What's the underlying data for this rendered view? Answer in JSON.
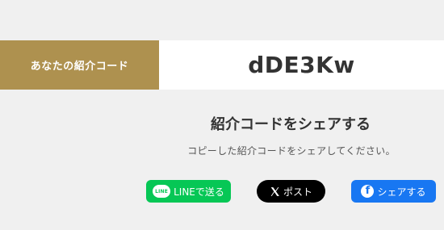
{
  "referral": {
    "label": "あなたの紹介コード",
    "code": "dDE3Kw"
  },
  "share": {
    "title": "紹介コードをシェアする",
    "description": "コピーした紹介コードをシェアしてください。"
  },
  "buttons": {
    "line": {
      "icon_text": "LINE",
      "label": "LINEで送る",
      "icon": "line-icon",
      "color": "#06c755"
    },
    "x": {
      "label": "ポスト",
      "icon": "x-logo-icon",
      "color": "#000000"
    },
    "facebook": {
      "label": "シェアする",
      "icon": "facebook-icon",
      "color": "#1877f2"
    }
  },
  "colors": {
    "label_bg": "#ae914f",
    "background": "#f0f0f0"
  }
}
